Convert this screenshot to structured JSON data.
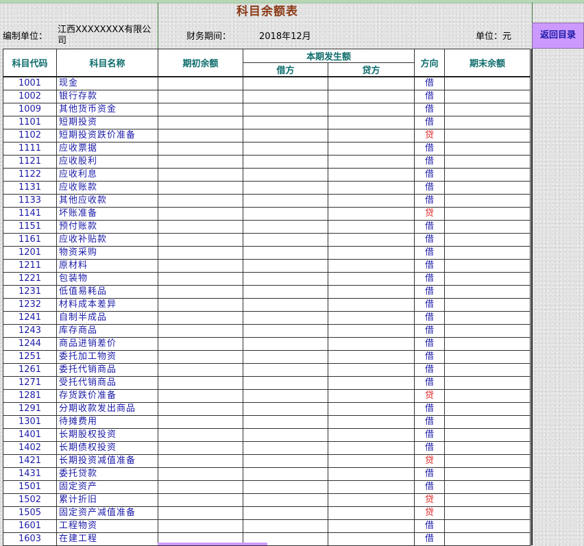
{
  "title": "科目余额表",
  "header": {
    "unit_label": "编制单位：",
    "unit_value": "江西XXXXXXXX有限公司",
    "period_label": "财务期间：",
    "period_value": "2018年12月",
    "currency_label": "单位：元",
    "back_button": "返回目录"
  },
  "columns": {
    "code": "科目代码",
    "name": "科目名称",
    "opening": "期初余额",
    "current": "本期发生额",
    "debit": "借方",
    "credit": "贷方",
    "direction": "方向",
    "closing": "期末余额"
  },
  "colors": {
    "debit_text": "#1a1aa8",
    "credit_text": "#e02020",
    "title": "#8b3a16",
    "header_text": "#0d6b6b",
    "button_bg": "#cc99ff"
  },
  "rows": [
    {
      "code": "1001",
      "name": "现金",
      "dir": "借"
    },
    {
      "code": "1002",
      "name": "银行存款",
      "dir": "借"
    },
    {
      "code": "1009",
      "name": "其他货币资金",
      "dir": "借"
    },
    {
      "code": "1101",
      "name": "短期投资",
      "dir": "借"
    },
    {
      "code": "1102",
      "name": "短期投资跌价准备",
      "dir": "贷"
    },
    {
      "code": "1111",
      "name": "应收票据",
      "dir": "借"
    },
    {
      "code": "1121",
      "name": "应收股利",
      "dir": "借"
    },
    {
      "code": "1122",
      "name": "应收利息",
      "dir": "借"
    },
    {
      "code": "1131",
      "name": "应收账款",
      "dir": "借"
    },
    {
      "code": "1133",
      "name": "其他应收款",
      "dir": "借"
    },
    {
      "code": "1141",
      "name": "坏账准备",
      "dir": "贷"
    },
    {
      "code": "1151",
      "name": "预付账款",
      "dir": "借"
    },
    {
      "code": "1161",
      "name": "应收补贴款",
      "dir": "借"
    },
    {
      "code": "1201",
      "name": "物资采购",
      "dir": "借"
    },
    {
      "code": "1211",
      "name": "原材料",
      "dir": "借"
    },
    {
      "code": "1221",
      "name": "包装物",
      "dir": "借"
    },
    {
      "code": "1231",
      "name": "低值易耗品",
      "dir": "借"
    },
    {
      "code": "1232",
      "name": "材料成本差异",
      "dir": "借"
    },
    {
      "code": "1241",
      "name": "自制半成品",
      "dir": "借"
    },
    {
      "code": "1243",
      "name": "库存商品",
      "dir": "借"
    },
    {
      "code": "1244",
      "name": "商品进销差价",
      "dir": "借"
    },
    {
      "code": "1251",
      "name": "委托加工物资",
      "dir": "借"
    },
    {
      "code": "1261",
      "name": "委托代销商品",
      "dir": "借"
    },
    {
      "code": "1271",
      "name": "受托代销商品",
      "dir": "借"
    },
    {
      "code": "1281",
      "name": "存货跌价准备",
      "dir": "贷"
    },
    {
      "code": "1291",
      "name": "分期收款发出商品",
      "dir": "借"
    },
    {
      "code": "1301",
      "name": "待摊费用",
      "dir": "借"
    },
    {
      "code": "1401",
      "name": "长期股权投资",
      "dir": "借"
    },
    {
      "code": "1402",
      "name": "长期债权投资",
      "dir": "借"
    },
    {
      "code": "1421",
      "name": "长期投资减值准备",
      "dir": "贷"
    },
    {
      "code": "1431",
      "name": "委托贷款",
      "dir": "借"
    },
    {
      "code": "1501",
      "name": "固定资产",
      "dir": "借"
    },
    {
      "code": "1502",
      "name": "累计折旧",
      "dir": "贷"
    },
    {
      "code": "1505",
      "name": "固定资产减值准备",
      "dir": "贷"
    },
    {
      "code": "1601",
      "name": "工程物资",
      "dir": "借"
    },
    {
      "code": "1603",
      "name": "在建工程",
      "dir": "借"
    }
  ]
}
